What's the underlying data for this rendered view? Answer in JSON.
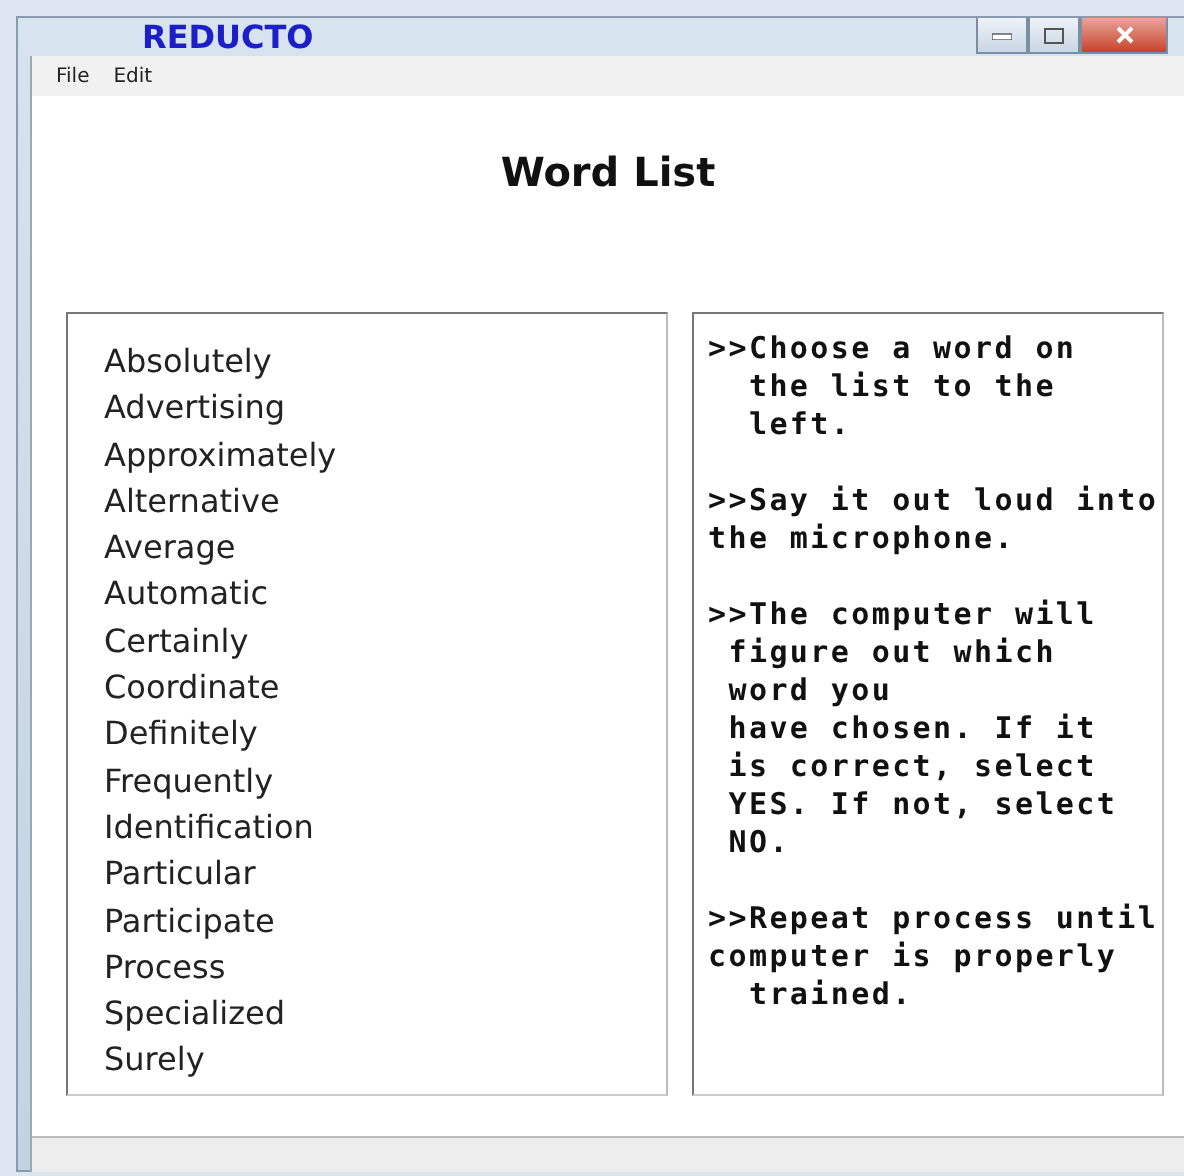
{
  "window": {
    "title": "REDUCTO"
  },
  "menu": [
    "File",
    "Edit"
  ],
  "heading": "Word List",
  "words": [
    {
      "label": "Absolutely",
      "selected": false
    },
    {
      "label": "Advertising",
      "selected": false
    },
    {
      "label": "Approximately",
      "selected": false
    },
    {
      "label": "Alternative",
      "selected": false
    },
    {
      "label": "Average",
      "selected": false
    },
    {
      "label": "Automatic",
      "selected": false
    },
    {
      "label": "Certainly",
      "selected": false
    },
    {
      "label": "Coordinate",
      "selected": false
    },
    {
      "label": "Definitely",
      "selected": false
    },
    {
      "label": "Frequently",
      "selected": false
    },
    {
      "label": "Identification",
      "selected": false
    },
    {
      "label": "Particular",
      "selected": false
    },
    {
      "label": "Participate",
      "selected": false
    },
    {
      "label": "Process",
      "selected": false
    },
    {
      "label": "Specialized",
      "selected": false
    },
    {
      "label": "Surely",
      "selected": false
    }
  ],
  "instructions": [
    ">>Choose a word on\n  the list to the\n  left.",
    ">>Say it out loud into\nthe microphone.",
    ">>The computer will\n figure out which\n word you\n have chosen. If it\n is correct, select\n YES. If not, select\n NO.",
    ">>Repeat process until\ncomputer is properly\n  trained."
  ]
}
